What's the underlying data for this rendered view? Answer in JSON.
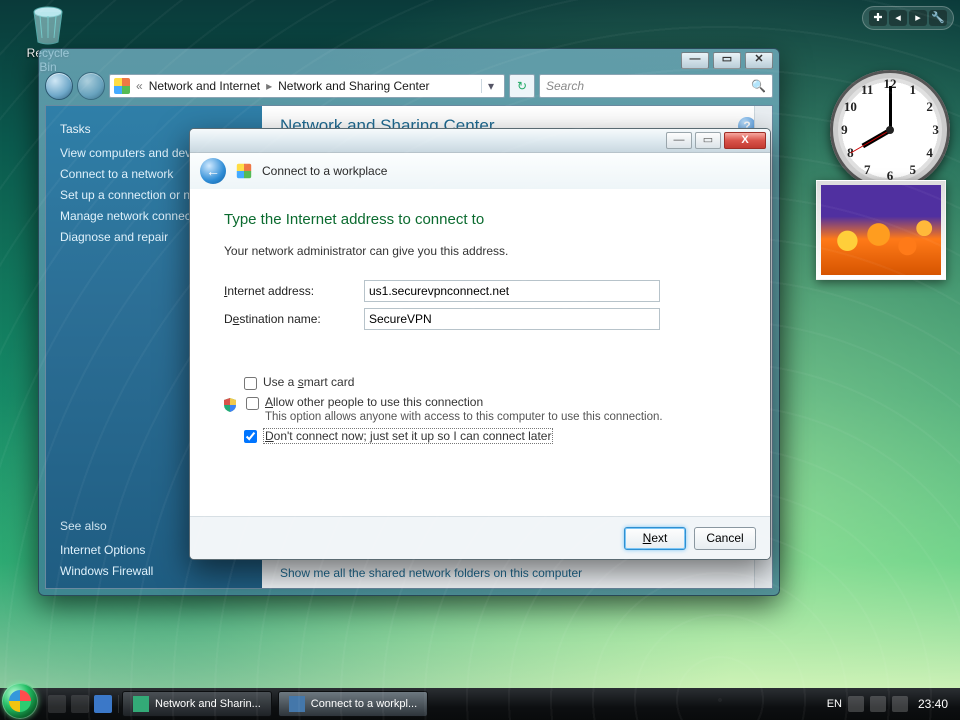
{
  "desktop": {
    "recycle_label": "Recycle Bin"
  },
  "gadgets": {
    "plus": "✚",
    "left": "◂",
    "right": "▸",
    "tool": "🔧"
  },
  "clock": {
    "hour_angle": 240,
    "minute_angle": 0,
    "second_angle": 240
  },
  "cp": {
    "breadcrumb": {
      "root_icon": "cp",
      "c1": "Network and Internet",
      "c2": "Network and Sharing Center"
    },
    "search_placeholder": "Search",
    "title": "Network and Sharing Center",
    "tasks_hdr": "Tasks",
    "tasks": [
      "View computers and devices",
      "Connect to a network",
      "Set up a connection or network",
      "Manage network connections",
      "Diagnose and repair"
    ],
    "seealso_hdr": "See also",
    "seealso": [
      "Internet Options",
      "Windows Firewall"
    ],
    "bottom_link": "Show me all the shared network folders on this computer"
  },
  "wizard": {
    "window_title": "Connect to a workplace",
    "heading": "Type the Internet address to connect to",
    "instruction": "Your network administrator can give you this address.",
    "addr_label_pre": "I",
    "addr_label_mid": "nternet address:",
    "addr_value": "us1.securevpnconnect.net",
    "dest_label_pre": "D",
    "dest_label_mid": "e",
    "dest_label_rest": "stination name:",
    "dest_value": "SecureVPN",
    "smartcard_pre": "Use a ",
    "smartcard_u": "s",
    "smartcard_post": "mart card",
    "allow_pre": "",
    "allow_u": "A",
    "allow_post": "llow other people to use this connection",
    "allow_sub": "This option allows anyone with access to this computer to use this connection.",
    "dont_pre": "",
    "dont_u": "D",
    "dont_post": "on't connect now; just set it up so I can connect later",
    "smartcard_checked": false,
    "allow_checked": false,
    "dont_checked": true,
    "next": "Next",
    "cancel": "Cancel"
  },
  "taskbar": {
    "btn1": "Network and Sharin...",
    "btn2": "Connect to a workpl...",
    "lang": "EN",
    "time": "23:40"
  }
}
